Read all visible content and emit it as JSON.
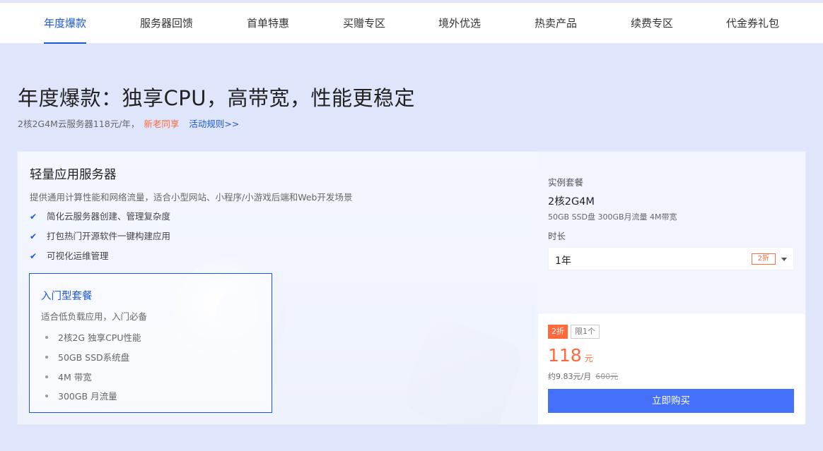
{
  "nav": {
    "tabs": [
      {
        "label": "年度爆款",
        "active": true
      },
      {
        "label": "服务器回馈",
        "active": false
      },
      {
        "label": "首单特惠",
        "active": false
      },
      {
        "label": "买赠专区",
        "active": false
      },
      {
        "label": "境外优选",
        "active": false
      },
      {
        "label": "热卖产品",
        "active": false
      },
      {
        "label": "续费专区",
        "active": false
      },
      {
        "label": "代金券礼包",
        "active": false
      }
    ]
  },
  "hero": {
    "title": "年度爆款：独享CPU，高带宽，性能更稳定",
    "subtitle": "2核2G4M云服务器118元/年，",
    "highlight": "新老同享",
    "link": "活动规则>>"
  },
  "product": {
    "title": "轻量应用服务器",
    "description": "提供通用计算性能和网络流量，适合小型网站、小程序/小游戏后端和Web开发场景",
    "features": [
      "简化云服务器创建、管理复杂度",
      "打包热门开源软件一键构建应用",
      "可视化运维管理"
    ],
    "package": {
      "title": "入门型套餐",
      "description": "适合低负载应用，入门必备",
      "items": [
        "2核2G 独享CPU性能",
        "50GB SSD系统盘",
        "4M 带宽",
        "300GB 月流量"
      ]
    }
  },
  "order": {
    "instance_label": "实例套餐",
    "spec": "2核2G4M",
    "spec_detail": "50GB SSD盘 300GB月流量 4M带宽",
    "duration_label": "时长",
    "duration_value": "1年",
    "duration_badge": "2折",
    "discount_tag": "2折",
    "limit_tag": "限1个",
    "price": "118",
    "price_unit": "元",
    "monthly": "约9.83元/月",
    "original_price": "600元",
    "buy_label": "立即购买"
  },
  "colors": {
    "accent": "#1a57d7",
    "highlight": "#ff6a3d",
    "buy_button": "#4470fa",
    "page_bg": "#dfe6fb"
  }
}
